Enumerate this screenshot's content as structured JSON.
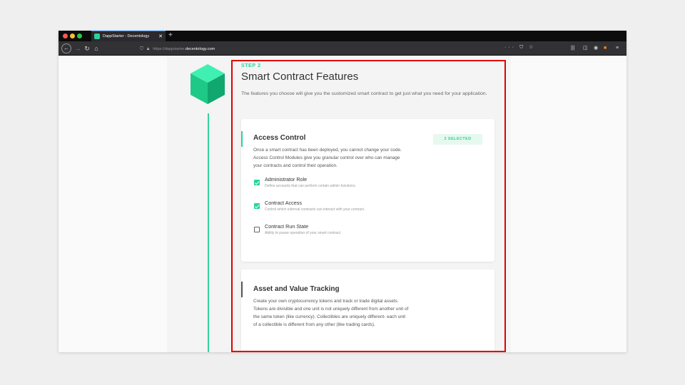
{
  "browser": {
    "tab_title": "DappStarter - Decentology",
    "tab_close": "✕",
    "new_tab": "+",
    "url_prefix": "https://dappstarter.",
    "url_domain": "decentology.com",
    "url_right_icons": "··· ⛉ ☆"
  },
  "page": {
    "step_label": "STEP 2",
    "title": "Smart Contract Features",
    "description": "The features you choose will give you the customized smart contract to get just what you need for your application."
  },
  "cards": [
    {
      "title": "Access Control",
      "description": "Once a smart contract has been deployed, you cannot change your code. Access Control Modules give you granular control over who can manage your contracts and control their operation.",
      "badge": "2 SELECTED",
      "options": [
        {
          "name": "Administrator Role",
          "sub": "Define accounts that can perform certain admin functions.",
          "checked": true
        },
        {
          "name": "Contract Access",
          "sub": "Control which external contracts can interact with your contract.",
          "checked": true
        },
        {
          "name": "Contract Run State",
          "sub": "Ability to pause operation of your smart contract.",
          "checked": false
        }
      ]
    },
    {
      "title": "Asset and Value Tracking",
      "description": "Create your own cryptocurrency tokens and track or trade digital assets. Tokens are divisible and one unit is not uniquely different from another unit of the same token (like currency). Collectibles are uniquely different- each unit of a collectible is different from any other (like trading cards)."
    }
  ],
  "colors": {
    "accent": "#2ad39b",
    "highlight": "#e00000"
  },
  "icons": {
    "back": "arrow-left-icon",
    "forward": "arrow-right-icon",
    "reload": "reload-icon",
    "home": "home-icon",
    "logo": "cube-icon"
  }
}
